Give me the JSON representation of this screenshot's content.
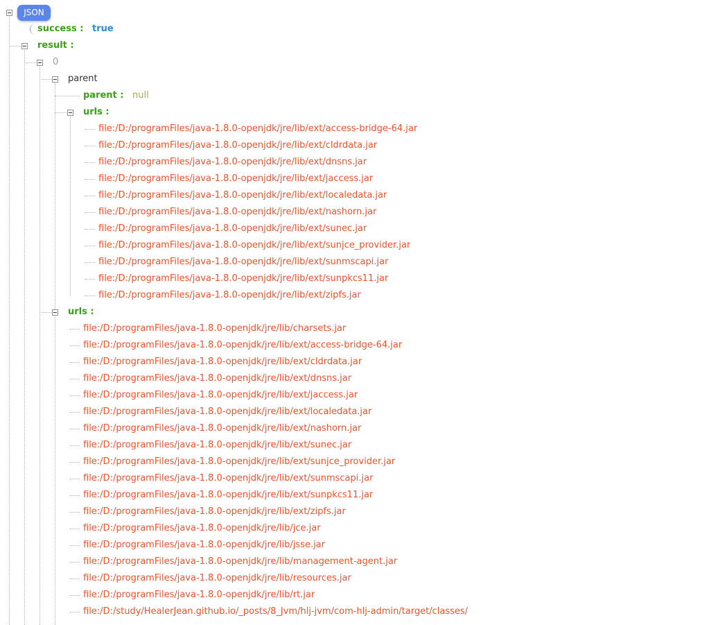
{
  "root": {
    "label": "JSON"
  },
  "success": {
    "key": "success :",
    "value": "true"
  },
  "result": {
    "key": "result :",
    "index": "0",
    "parent": {
      "label": "parent",
      "parent_key": "parent :",
      "parent_value": "null",
      "urls_key": "urls :",
      "urls": [
        "file:/D:/programFiles/java-1.8.0-openjdk/jre/lib/ext/access-bridge-64.jar",
        "file:/D:/programFiles/java-1.8.0-openjdk/jre/lib/ext/cldrdata.jar",
        "file:/D:/programFiles/java-1.8.0-openjdk/jre/lib/ext/dnsns.jar",
        "file:/D:/programFiles/java-1.8.0-openjdk/jre/lib/ext/jaccess.jar",
        "file:/D:/programFiles/java-1.8.0-openjdk/jre/lib/ext/localedata.jar",
        "file:/D:/programFiles/java-1.8.0-openjdk/jre/lib/ext/nashorn.jar",
        "file:/D:/programFiles/java-1.8.0-openjdk/jre/lib/ext/sunec.jar",
        "file:/D:/programFiles/java-1.8.0-openjdk/jre/lib/ext/sunjce_provider.jar",
        "file:/D:/programFiles/java-1.8.0-openjdk/jre/lib/ext/sunmscapi.jar",
        "file:/D:/programFiles/java-1.8.0-openjdk/jre/lib/ext/sunpkcs11.jar",
        "file:/D:/programFiles/java-1.8.0-openjdk/jre/lib/ext/zipfs.jar"
      ]
    },
    "urls_key": "urls :",
    "urls": [
      "file:/D:/programFiles/java-1.8.0-openjdk/jre/lib/charsets.jar",
      "file:/D:/programFiles/java-1.8.0-openjdk/jre/lib/ext/access-bridge-64.jar",
      "file:/D:/programFiles/java-1.8.0-openjdk/jre/lib/ext/cldrdata.jar",
      "file:/D:/programFiles/java-1.8.0-openjdk/jre/lib/ext/dnsns.jar",
      "file:/D:/programFiles/java-1.8.0-openjdk/jre/lib/ext/jaccess.jar",
      "file:/D:/programFiles/java-1.8.0-openjdk/jre/lib/ext/localedata.jar",
      "file:/D:/programFiles/java-1.8.0-openjdk/jre/lib/ext/nashorn.jar",
      "file:/D:/programFiles/java-1.8.0-openjdk/jre/lib/ext/sunec.jar",
      "file:/D:/programFiles/java-1.8.0-openjdk/jre/lib/ext/sunjce_provider.jar",
      "file:/D:/programFiles/java-1.8.0-openjdk/jre/lib/ext/sunmscapi.jar",
      "file:/D:/programFiles/java-1.8.0-openjdk/jre/lib/ext/sunpkcs11.jar",
      "file:/D:/programFiles/java-1.8.0-openjdk/jre/lib/ext/zipfs.jar",
      "file:/D:/programFiles/java-1.8.0-openjdk/jre/lib/jce.jar",
      "file:/D:/programFiles/java-1.8.0-openjdk/jre/lib/jsse.jar",
      "file:/D:/programFiles/java-1.8.0-openjdk/jre/lib/management-agent.jar",
      "file:/D:/programFiles/java-1.8.0-openjdk/jre/lib/resources.jar",
      "file:/D:/programFiles/java-1.8.0-openjdk/jre/lib/rt.jar",
      "file:/D:/study/HealerJean.github.io/_posts/8_Jvm/hlj-jvm/com-hlj-admin/target/classes/"
    ]
  },
  "colors": {
    "key": "#3aa016",
    "bool": "#2b8ad1",
    "null": "#b2a53c",
    "string": "#f0502a",
    "root_badge": "#5b86e8"
  }
}
